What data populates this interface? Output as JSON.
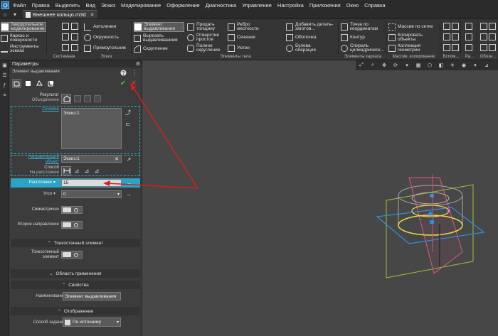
{
  "menu": {
    "items": [
      "Файл",
      "Правка",
      "Выделить",
      "Вид",
      "Эскиз",
      "Моделирование",
      "Оформление",
      "Диагностика",
      "Управление",
      "Настройка",
      "Приложения",
      "Окно",
      "Справка"
    ]
  },
  "tabbar": {
    "home_icon": "home-icon",
    "doc_title": "Внешнее кольцо.m3d",
    "close_glyph": "✕"
  },
  "ribbon": {
    "mode_items": [
      "Твердотельное моделирование",
      "Каркас и поверхности",
      "Инструменты эскиза"
    ],
    "group_labels": [
      "Системная",
      "Эскиз",
      "Элементы тела",
      "Элементы каркаса",
      "Массив, копирование",
      "Вспом...",
      "Ра...",
      "Обозн..."
    ],
    "sketch_items": [
      "Автолиния",
      "Окружность",
      "Прямоугольник"
    ],
    "body_items": {
      "col1": [
        "Элемент выдавливания",
        "Вырезать выдавливанием",
        "Скругление"
      ],
      "col2": [
        "Придать толщину",
        "Отверстие простое",
        "Полное скругление"
      ],
      "col3": [
        "Ребро жесткости",
        "Сечение",
        "Уклон"
      ],
      "col4": [
        "Добавить деталь-заготов...",
        "Оболочка",
        "Булева операция"
      ]
    },
    "frame_items": [
      "Точка по координатам",
      "Контур",
      "Спираль цилиндрическ..."
    ],
    "array_items": [
      "Массив по сетке",
      "Копировать объекты",
      "Коллекция геометрии"
    ]
  },
  "panel": {
    "title": "Параметры",
    "operation": "Элемент выдавливания",
    "help_glyph": "?",
    "ok_glyph": "✔",
    "cancel_glyph": "✕",
    "result_label": "Результат",
    "result_sub": "Объединение",
    "sections_label": "Сечение",
    "sections_value": "Эскиз:1",
    "direction_label": "Направляющий",
    "direction_label2": "объект",
    "direction_value": "Эскиз:1",
    "method_label": "Способ",
    "method_sub": "На расстояние",
    "distance_label": "Расстояние",
    "distance_value": "15",
    "angle_label": "Угол",
    "angle_value": "0",
    "symmetric_label": "Симметрично",
    "second_dir_label": "Второе направление",
    "thin_section": "Тонкостенный элемент",
    "thin_label": "Тонкостенный",
    "thin_label2": "элемент",
    "scope_section": "Область применения",
    "props_section": "Свойства",
    "name_label": "Наименование",
    "name_value": "Элемент выдавливания",
    "display_section": "Отображение",
    "mode_label": "Способ задания",
    "mode_value": "По источнику"
  },
  "colors": {
    "accent": "#2aa3c4",
    "ok": "#37c043",
    "cancel": "#e03a3a",
    "arrow": "#d42020",
    "frame_plane": "#9ac53a",
    "side_plane": "#d75c7a",
    "xy_plane": "#2e8fe0",
    "part": "#e8d84a"
  }
}
